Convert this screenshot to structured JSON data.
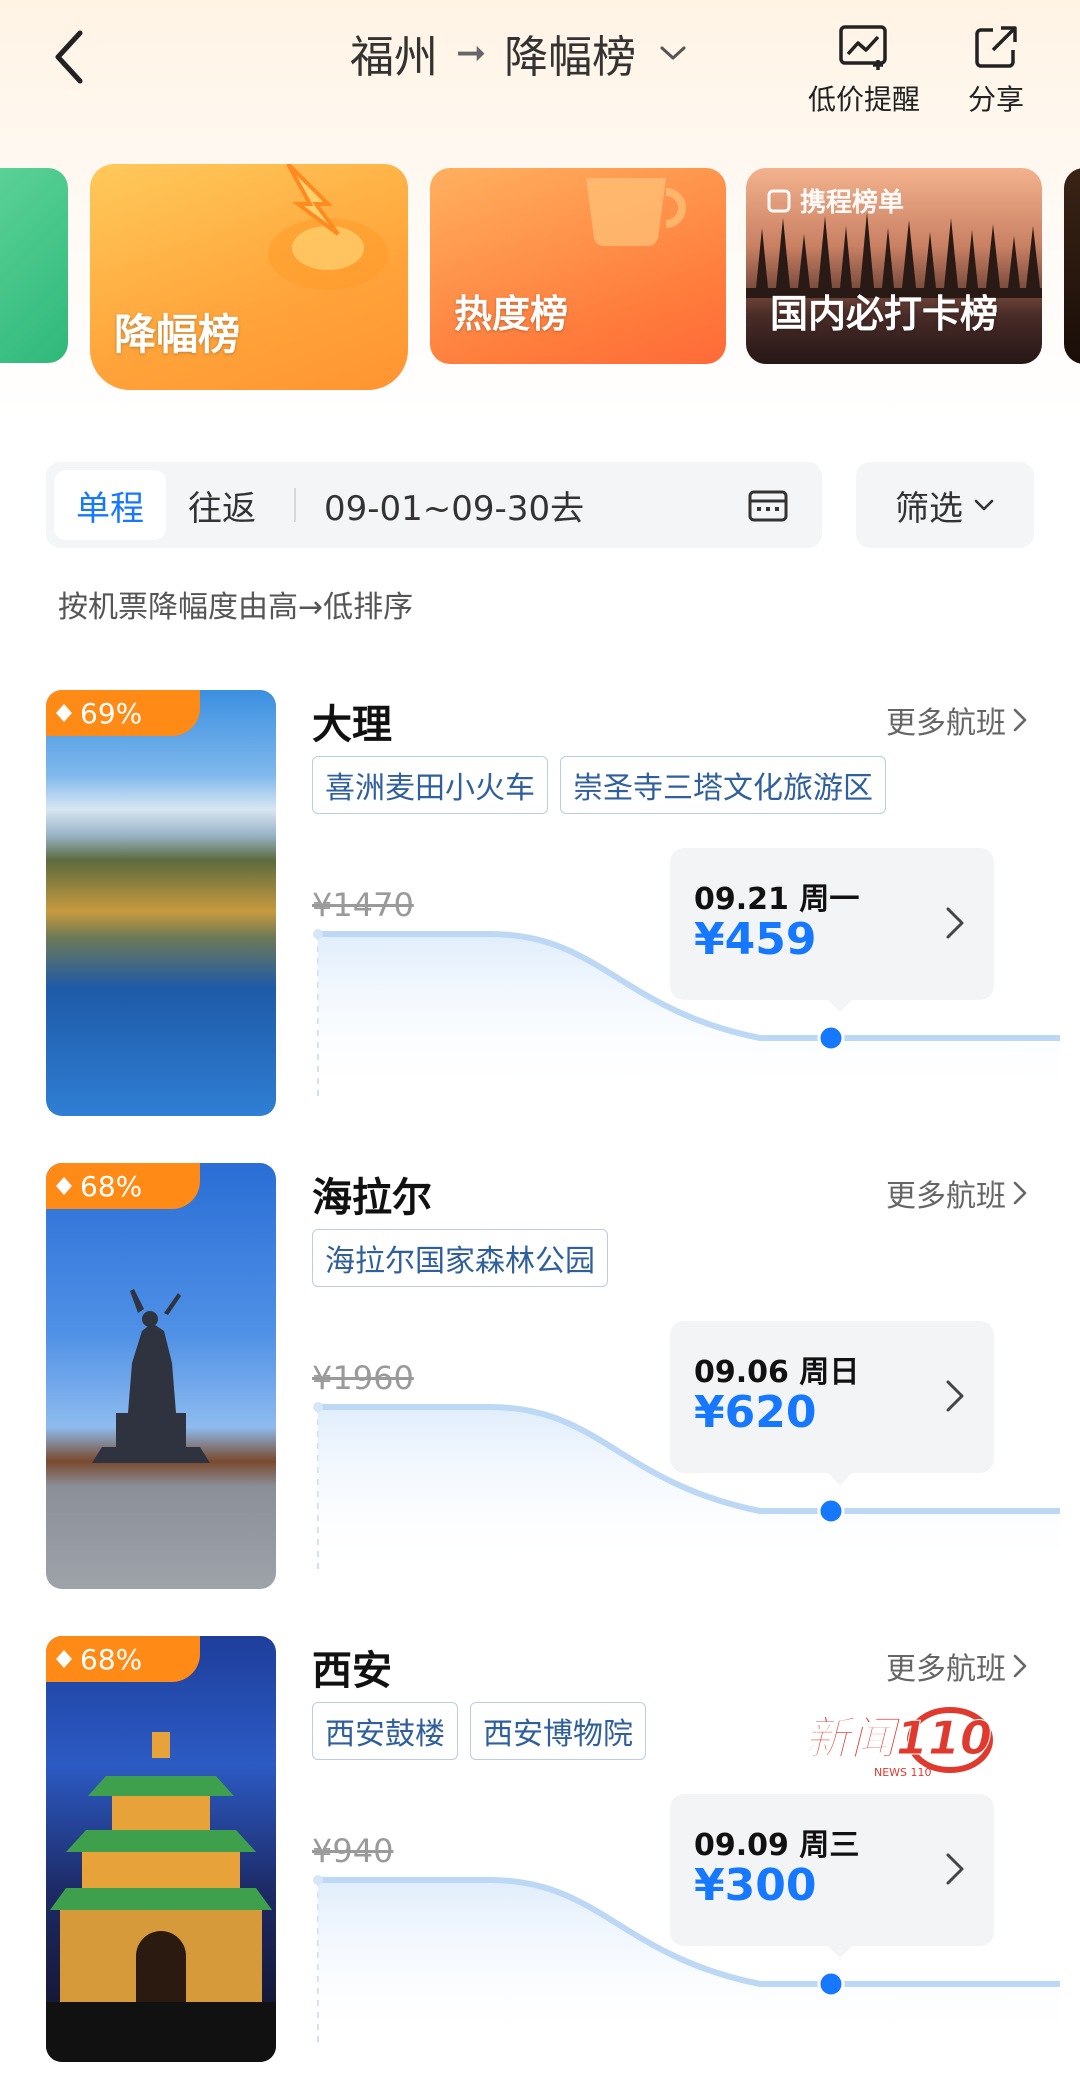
{
  "header": {
    "origin": "福州",
    "separator": "➞",
    "board": "降幅榜",
    "alert_label": "低价提醒",
    "share_label": "分享"
  },
  "rankings": [
    {
      "label": "降幅榜",
      "active": true
    },
    {
      "label": "热度榜",
      "active": false
    },
    {
      "label": "国内必打卡榜",
      "badge": "携程榜单",
      "active": false
    }
  ],
  "filter": {
    "one_way": "单程",
    "round_trip": "往返",
    "date_range": "09-01~09-30去",
    "filter_label": "筛选"
  },
  "sort_note": "按机票降幅度由高→低排序",
  "destinations": [
    {
      "drop": "69%",
      "name": "大理",
      "more": "更多航班",
      "tags": [
        "喜洲麦田小火车",
        "崇圣寺三塔文化旅游区"
      ],
      "old_price": "¥1470",
      "date": "09.21 周一",
      "price": "¥459"
    },
    {
      "drop": "68%",
      "name": "海拉尔",
      "more": "更多航班",
      "tags": [
        "海拉尔国家森林公园"
      ],
      "old_price": "¥1960",
      "date": "09.06 周日",
      "price": "¥620"
    },
    {
      "drop": "68%",
      "name": "西安",
      "more": "更多航班",
      "tags": [
        "西安鼓楼",
        "西安博物院"
      ],
      "old_price": "¥940",
      "date": "09.09 周三",
      "price": "¥300"
    }
  ],
  "watermark": {
    "text": "新闻110",
    "sub": "NEWS 110"
  },
  "colors": {
    "accent": "#1677ff",
    "badge": "#ff8a16",
    "active_tab": "#ffa43a"
  }
}
